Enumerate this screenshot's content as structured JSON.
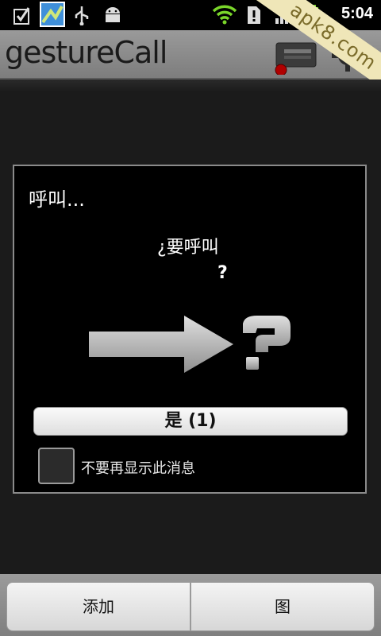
{
  "status_bar": {
    "time": "5:04",
    "icons": [
      "checkbox-icon",
      "image-icon",
      "usb-icon",
      "android-icon",
      "wifi-icon",
      "alert-icon",
      "signal-icon",
      "battery-icon"
    ]
  },
  "watermark": "apk8.com",
  "app": {
    "title": "gestureCall"
  },
  "dialog": {
    "title": "呼叫...",
    "message": "¿要呼叫",
    "question_mark": "?",
    "yes_button": "是 (1)",
    "checkbox_label": "不要再显示此消息",
    "checkbox_checked": false
  },
  "bottom_bar": {
    "left_label": "添加",
    "right_label": "图"
  },
  "colors": {
    "title_bar": "#8f8f8f",
    "dialog_bg": "#000000",
    "wifi_green": "#7ad62a",
    "record_red": "#b00000"
  }
}
